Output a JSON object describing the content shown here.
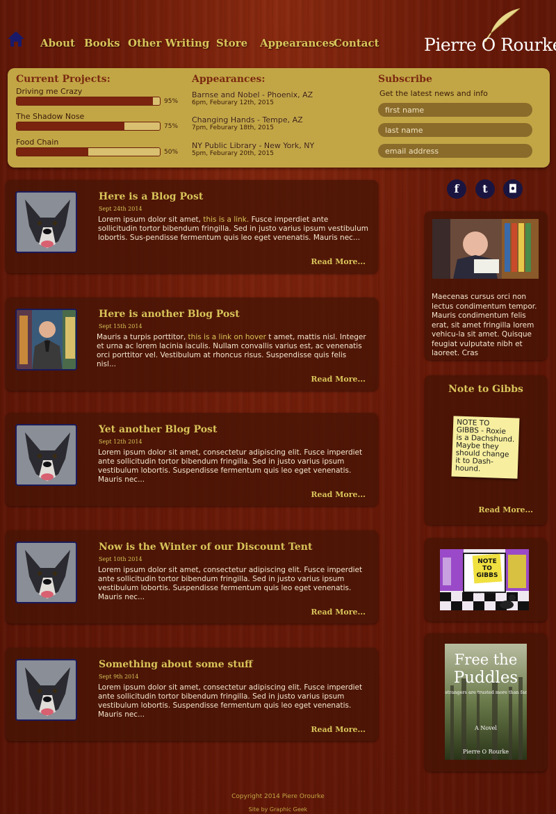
{
  "nav": {
    "home_icon": "home-icon",
    "items": [
      "About",
      "Books",
      "Other Writing",
      "Store",
      "Appearances",
      "Contact"
    ],
    "logo_text": "Pierre O Rourke"
  },
  "projects": {
    "heading": "Current Projects:",
    "items": [
      {
        "title": "Driving me Crazy",
        "percent": 95,
        "percent_label": "95%"
      },
      {
        "title": "The Shadow Nose",
        "percent": 75,
        "percent_label": "75%"
      },
      {
        "title": "Food Chain",
        "percent": 50,
        "percent_label": "50%"
      }
    ]
  },
  "appearances": {
    "heading": "Appearances:",
    "items": [
      {
        "title": "Barnse and Nobel - Phoenix, AZ",
        "date": "6pm, Feburary 12th, 2015"
      },
      {
        "title": "Changing Hands - Tempe, AZ",
        "date": "7pm, Feburary 18th, 2015"
      },
      {
        "title": "NY Public Library - New York, NY",
        "date": "5pm, Feburary 20th, 2015"
      }
    ]
  },
  "subscribe": {
    "heading": "Subscribe",
    "description": "Get the latest news and info",
    "first_name_placeholder": "first name",
    "last_name_placeholder": "last name",
    "email_placeholder": "email address"
  },
  "posts": [
    {
      "title": "Here is a Blog Post",
      "date": "Sept 24th 2014",
      "body_before": "Lorem ipsum dolor sit amet, ",
      "link": "this is a link.",
      "body_after": " Fusce imperdiet ante sollicitudin tortor bibendum fringilla. Sed in justo varius ipsum vestibulum lobortis. Sus-pendisse fermentum quis leo eget venenatis. Mauris nec...",
      "read_more": "Read More...",
      "thumb": "dog-photo"
    },
    {
      "title": "Here is another Blog Post",
      "date": "Sept 15th 2014",
      "body_before": "Mauris a turpis porttitor, ",
      "link": "this is a link on hover",
      "body_after": " t amet, mattis nisl. Integer et urna ac lorem lacinia iaculis. Nullam convallis varius est, ac venenatis orci porttitor vel. Vestibulum at rhoncus risus. Suspendisse quis felis nisl...",
      "read_more": "Read More...",
      "thumb": "author-photo"
    },
    {
      "title": "Yet another Blog Post",
      "date": "Sept 12th 2014",
      "body_before": "Lorem ipsum dolor sit amet, consectetur adipiscing elit. Fusce imperdiet ante sollicitudin tortor bibendum fringilla. Sed in justo varius ipsum vestibulum lobortis. Suspendisse fermentum quis leo eget venenatis. Mauris nec...",
      "link": "",
      "body_after": "",
      "read_more": "Read More...",
      "thumb": "dog-photo"
    },
    {
      "title": "Now is the Winter of our Discount Tent",
      "date": "Sept 10th 2014",
      "body_before": "Lorem ipsum dolor sit amet, consectetur adipiscing elit. Fusce imperdiet ante sollicitudin tortor bibendum fringilla. Sed in justo varius ipsum vestibulum lobortis. Suspendisse fermentum quis leo eget venenatis. Mauris nec...",
      "link": "",
      "body_after": "",
      "read_more": "Read More...",
      "thumb": "dog-photo"
    },
    {
      "title": "Something about some stuff",
      "date": "Sept 9th 2014",
      "body_before": "Lorem ipsum dolor sit amet, consectetur adipiscing elit. Fusce imperdiet ante sollicitudin tortor bibendum fringilla. Sed in justo varius ipsum vestibulum lobortis. Suspendisse fermentum quis leo eget venenatis. Mauris nec...",
      "link": "",
      "body_after": "",
      "read_more": "Read More...",
      "thumb": "dog-photo"
    }
  ],
  "social": [
    {
      "icon": "facebook-icon",
      "glyph": "f"
    },
    {
      "icon": "tumblr-icon",
      "glyph": "t"
    },
    {
      "icon": "instagram-icon",
      "glyph": "◘"
    }
  ],
  "sidebar": {
    "about_text": "Maecenas cursus orci non lectus condimentum tempor. Mauris condimentum felis erat, sit amet fringilla lorem vehicu-la sit amet. Quisque feugiat vulputate nibh et laoreet. Cras",
    "note_heading": "Note to Gibbs",
    "note_text": "NOTE TO\nGIBBS - Roxie\nis a Dachshund.\nMaybe they\nshould change\nit to Dash-\nhound.",
    "note_read_more": "Read More...",
    "book1_title_line1": "NOTE",
    "book1_title_line2": "TO",
    "book1_title_line3": "GIBBS",
    "book1_author": "Pierre O Rourke",
    "book2_title_line1": "Free the",
    "book2_title_line2": "Puddles",
    "book2_tagline": "When strangers are trusted more than family.....",
    "book2_subtitle": "A Novel",
    "book2_author": "Pierre O Rourke"
  },
  "footer": {
    "copyright": "Copyright 2014 Piere Orourke",
    "credit": "Site by Graphic Geek"
  },
  "colors": {
    "accent_gold": "#d8c45a",
    "panel_gold": "#c2a646",
    "background_mahogany": "#6a1a08",
    "progress_fill": "#7a2410",
    "nav_home": "#1a1a6a"
  }
}
